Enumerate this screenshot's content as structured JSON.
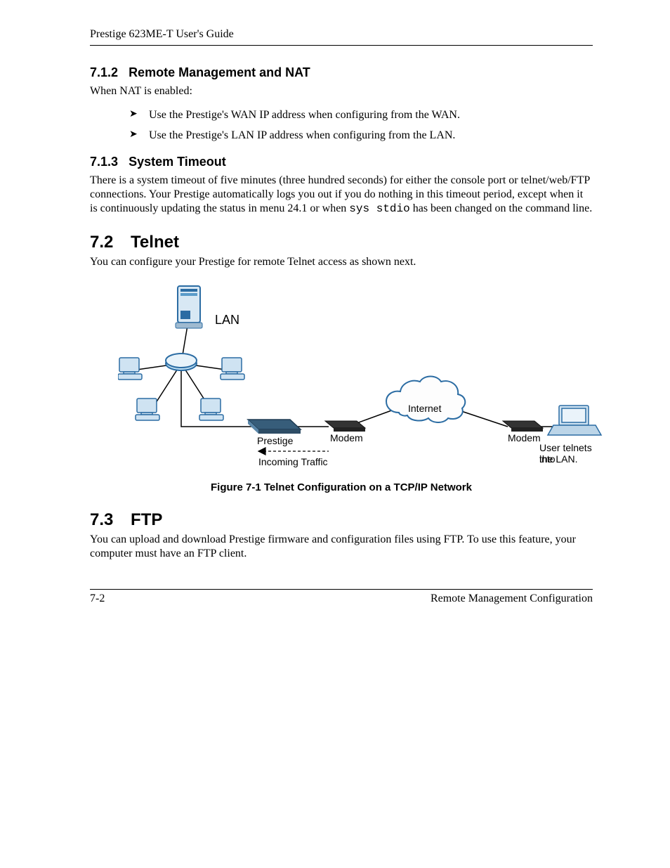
{
  "header": {
    "title": "Prestige 623ME-T User's Guide"
  },
  "sections": {
    "s712": {
      "num": "7.1.2",
      "title": "Remote Management and NAT",
      "intro": "When NAT is enabled:",
      "bullets": [
        "Use the Prestige's WAN IP address when configuring from the WAN.",
        "Use the Prestige's LAN IP address when configuring from the LAN."
      ]
    },
    "s713": {
      "num": "7.1.3",
      "title": "System Timeout",
      "body_a": "There is a system timeout of five minutes (three hundred seconds) for either the console port or telnet/web/FTP connections. Your Prestige automatically logs you out if you do nothing in this timeout period, except when it is continuously updating the status in menu 24.1 or when ",
      "body_code": "sys stdio",
      "body_b": " has been changed on the command line."
    },
    "s72": {
      "num": "7.2",
      "title": "Telnet",
      "body": "You can configure your Prestige for remote Telnet access as shown next."
    },
    "figure": {
      "caption": "Figure 7-1 Telnet Configuration on a TCP/IP Network",
      "labels": {
        "lan": "LAN",
        "internet": "Internet",
        "prestige": "Prestige",
        "modem1": "Modem",
        "modem2": "Modem",
        "incoming": "Incoming Traffic",
        "user1": "User telnets into",
        "user2": "the LAN."
      }
    },
    "s73": {
      "num": "7.3",
      "title": "FTP",
      "body": "You can upload and download Prestige firmware and configuration files using FTP. To use this feature, your computer must have an FTP client."
    }
  },
  "footer": {
    "page": "7-2",
    "chapter": "Remote Management Configuration"
  }
}
